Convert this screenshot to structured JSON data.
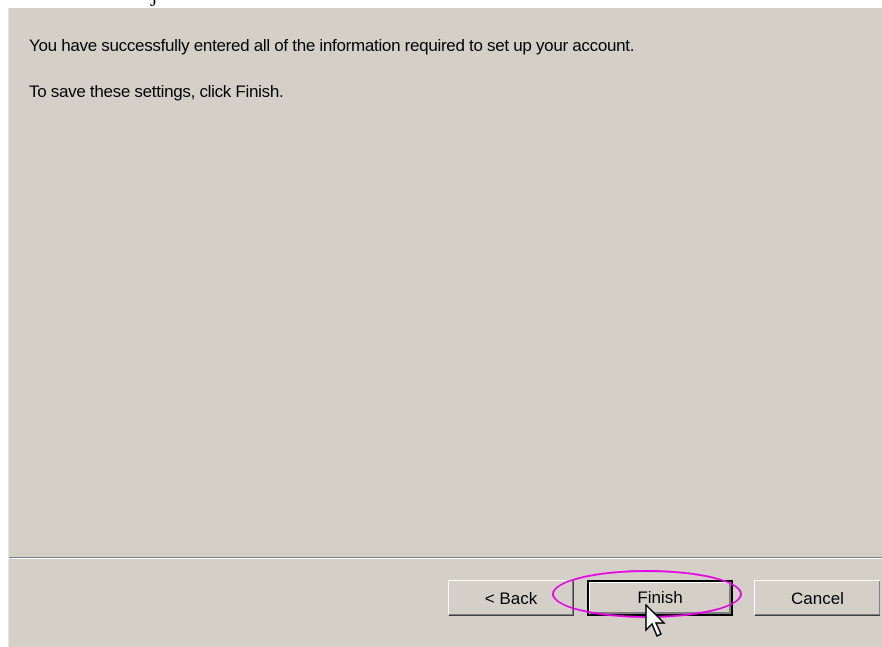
{
  "partial_heading": "J",
  "dialog": {
    "message_1": "You have successfully entered all of the information required to set up your account.",
    "message_2": "To save these settings, click Finish."
  },
  "buttons": {
    "back_label": "< Back",
    "finish_label": "Finish",
    "cancel_label": "Cancel"
  },
  "annotation": {
    "highlight_color": "#e600e6",
    "highlighted_target": "finish-button"
  },
  "icons": {
    "cursor": "mouse-pointer-icon"
  }
}
